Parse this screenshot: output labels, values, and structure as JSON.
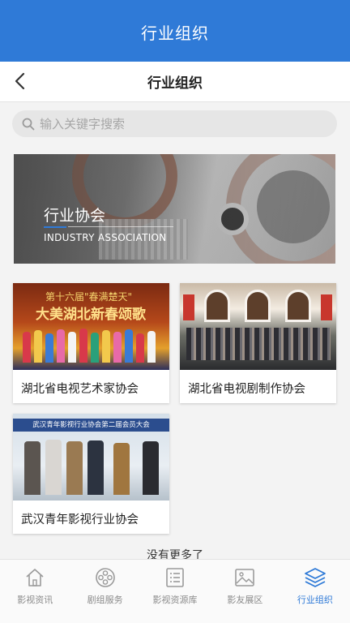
{
  "app_bar": {
    "title": "行业组织"
  },
  "nav": {
    "title": "行业组织",
    "back_icon": "chevron-left-icon"
  },
  "search": {
    "placeholder": "输入关键字搜索",
    "icon": "search-icon"
  },
  "banner": {
    "title": "行业协会",
    "subtitle": "INDUSTRY ASSOCIATION"
  },
  "organizations": [
    {
      "name": "湖北省电视艺术家协会",
      "photo_caption": "第十六届\"春满楚天\"",
      "photo_headline": "大美湖北新春颂歌"
    },
    {
      "name": "湖北省电视剧制作协会"
    },
    {
      "name": "武汉青年影视行业协会",
      "photo_caption": "武汉青年影视行业协会第二届会员大会"
    }
  ],
  "footer": {
    "no_more": "没有更多了"
  },
  "tabbar": {
    "active_index": 4,
    "accent_color": "#2f7ad7",
    "tabs": [
      {
        "label": "影视资讯",
        "icon": "home-icon"
      },
      {
        "label": "剧组服务",
        "icon": "film-reel-icon"
      },
      {
        "label": "影视资源库",
        "icon": "list-icon"
      },
      {
        "label": "影友展区",
        "icon": "image-icon"
      },
      {
        "label": "行业组织",
        "icon": "layers-icon"
      }
    ]
  }
}
